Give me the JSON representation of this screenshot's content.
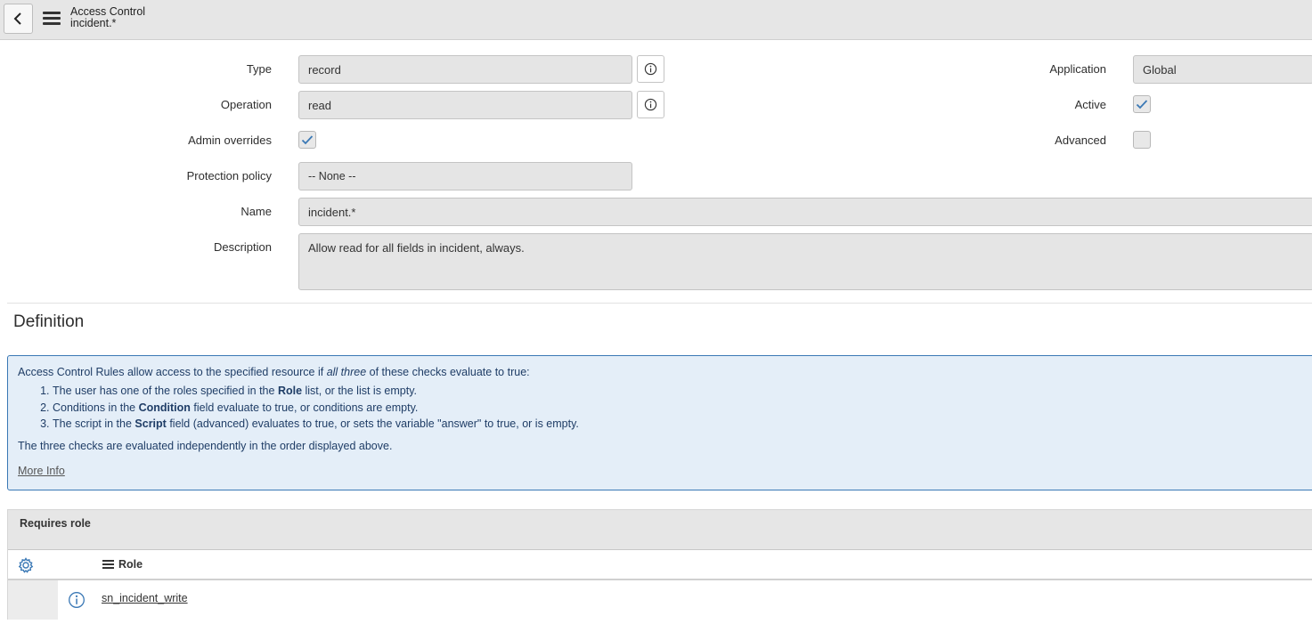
{
  "header": {
    "title": "Access Control",
    "subtitle": "incident.*"
  },
  "form": {
    "type": {
      "label": "Type",
      "value": "record"
    },
    "operation": {
      "label": "Operation",
      "value": "read"
    },
    "admin_overrides": {
      "label": "Admin overrides",
      "checked": true
    },
    "protection_policy": {
      "label": "Protection policy",
      "value": "-- None --"
    },
    "name": {
      "label": "Name",
      "value": "incident.*"
    },
    "description": {
      "label": "Description",
      "value": "Allow read for all fields in incident, always."
    },
    "application": {
      "label": "Application",
      "value": "Global"
    },
    "active": {
      "label": "Active",
      "checked": true
    },
    "advanced": {
      "label": "Advanced",
      "checked": false
    }
  },
  "definition": {
    "title": "Definition",
    "intro_before": "Access Control Rules allow access to the specified resource if ",
    "intro_em": "all three",
    "intro_after": " of these checks evaluate to true:",
    "items": [
      {
        "before": "The user has one of the roles specified in the ",
        "strong": "Role",
        "after": " list, or the list is empty."
      },
      {
        "before": "Conditions in the ",
        "strong": "Condition",
        "after": " field evaluate to true, or conditions are empty."
      },
      {
        "before": "The script in the ",
        "strong": "Script",
        "after": " field (advanced) evaluates to true, or sets the variable \"answer\" to true, or is empty."
      }
    ],
    "note": "The three checks are evaluated independently in the order displayed above.",
    "more_info": "More Info"
  },
  "related_list": {
    "title": "Requires role",
    "column": "Role",
    "rows": [
      {
        "role": "sn_incident_write"
      }
    ]
  },
  "colors": {
    "accent": "#3a78b5",
    "info_bg": "#e4eef8"
  }
}
